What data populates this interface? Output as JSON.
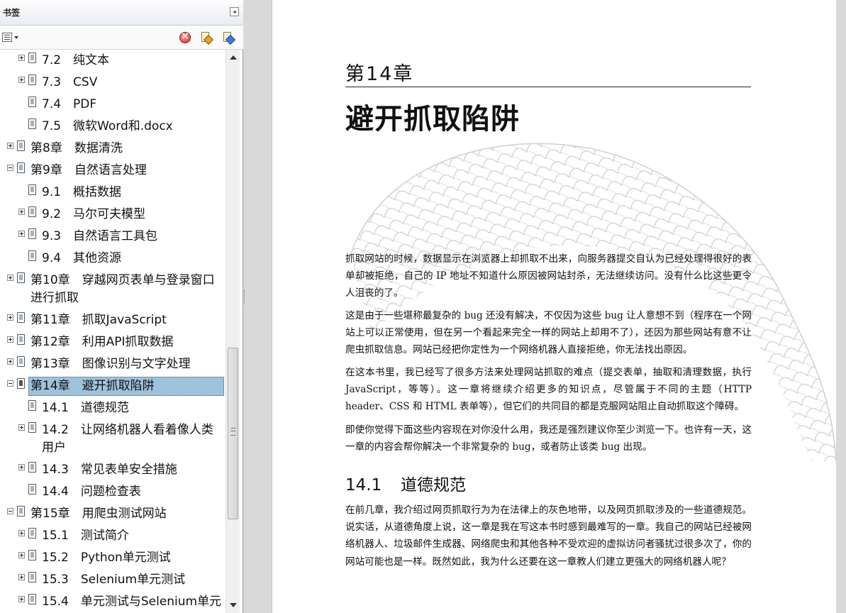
{
  "panel": {
    "title": "书签",
    "collapse_glyph": "◂",
    "toolbar": {
      "options_icon": "options-menu-icon",
      "delete_icon": "delete-bookmark-icon",
      "expand_icon": "expand-bookmark-icon",
      "goto_icon": "goto-bookmark-icon"
    }
  },
  "bookmarks": [
    {
      "label": "7.2　纯文本",
      "level": 2,
      "expander": "closed",
      "selected": false
    },
    {
      "label": "7.3　CSV",
      "level": 2,
      "expander": "closed",
      "selected": false
    },
    {
      "label": "7.4　PDF",
      "level": 2,
      "expander": "none",
      "selected": false
    },
    {
      "label": "7.5　微软Word和.docx",
      "level": 2,
      "expander": "none",
      "selected": false
    },
    {
      "label": "第8章　数据清洗",
      "level": 1,
      "expander": "closed",
      "selected": false
    },
    {
      "label": "第9章　自然语言处理",
      "level": 1,
      "expander": "open",
      "selected": false
    },
    {
      "label": "9.1　概括数据",
      "level": 2,
      "expander": "none",
      "selected": false
    },
    {
      "label": "9.2　马尔可夫模型",
      "level": 2,
      "expander": "closed",
      "selected": false
    },
    {
      "label": "9.3　自然语言工具包",
      "level": 2,
      "expander": "closed",
      "selected": false
    },
    {
      "label": "9.4　其他资源",
      "level": 2,
      "expander": "none",
      "selected": false
    },
    {
      "label": "第10章　穿越网页表单与登录窗口\n进行抓取",
      "level": 1,
      "expander": "closed",
      "selected": false
    },
    {
      "label": "第11章　抓取JavaScript",
      "level": 1,
      "expander": "closed",
      "selected": false
    },
    {
      "label": "第12章　利用API抓取数据",
      "level": 1,
      "expander": "closed",
      "selected": false
    },
    {
      "label": "第13章　图像识别与文字处理",
      "level": 1,
      "expander": "closed",
      "selected": false
    },
    {
      "label": "第14章　避开抓取陷阱",
      "level": 1,
      "expander": "open",
      "selected": true
    },
    {
      "label": "14.1　道德规范",
      "level": 2,
      "expander": "none",
      "selected": false
    },
    {
      "label": "14.2　让网络机器人看着像人类\n用户",
      "level": 2,
      "expander": "closed",
      "selected": false
    },
    {
      "label": "14.3　常见表单安全措施",
      "level": 2,
      "expander": "closed",
      "selected": false
    },
    {
      "label": "14.4　问题检查表",
      "level": 2,
      "expander": "none",
      "selected": false
    },
    {
      "label": "第15章　用爬虫测试网站",
      "level": 1,
      "expander": "open",
      "selected": false
    },
    {
      "label": "15.1　测试简介",
      "level": 2,
      "expander": "closed",
      "selected": false
    },
    {
      "label": "15.2　Python单元测试",
      "level": 2,
      "expander": "closed",
      "selected": false
    },
    {
      "label": "15.3　Selenium单元测试",
      "level": 2,
      "expander": "closed",
      "selected": false
    },
    {
      "label": "15.4　单元测试与Selenium单元",
      "level": 2,
      "expander": "closed",
      "selected": false
    }
  ],
  "document": {
    "chapter_label": "第14章",
    "chapter_title": "避开抓取陷阱",
    "paragraphs": [
      "抓取网站的时候，数据显示在浏览器上却抓取不出来，向服务器提交自认为已经处理得很好的表单却被拒绝，自己的 IP 地址不知道什么原因被网站封杀，无法继续访问。没有什么比这些更令人沮丧的了。",
      "这是由于一些堪称最复杂的 bug 还没有解决，不仅因为这些 bug 让人意想不到（程序在一个网站上可以正常使用，但在另一个看起来完全一样的网站上却用不了），还因为那些网站有意不让爬虫抓取信息。网站已经把你定性为一个网络机器人直接拒绝，你无法找出原因。",
      "在这本书里，我已经写了很多方法来处理网站抓取的难点（提交表单，抽取和清理数据，执行 JavaScript，等等）。这一章将继续介绍更多的知识点，尽管属于不同的主题（HTTP header、CSS 和 HTML 表单等），但它们的共同目的都是克服网站阻止自动抓取这个障碍。",
      "即使你觉得下面这些内容现在对你没什么用，我还是强烈建议你至少浏览一下。也许有一天，这一章的内容会帮你解决一个非常复杂的 bug，或者防止该类 bug 出现。",
      "在前几章，我介绍过网页抓取行为为在法律上的灰色地带，以及网页抓取涉及的一些道德规范。说实话，从道德角度上说，这一章是我在写这本书时感到最难写的一章。我自己的网站已经被网络机器人、垃圾邮件生成器、网络爬虫和其他各种不受欢迎的虚拟访问者骚扰过很多次了，你的网站可能也是一样。既然如此，我为什么还要在这一章教人们建立更强大的网络机器人呢？"
    ],
    "section": {
      "number": "14.1",
      "title": "道德规范"
    }
  }
}
